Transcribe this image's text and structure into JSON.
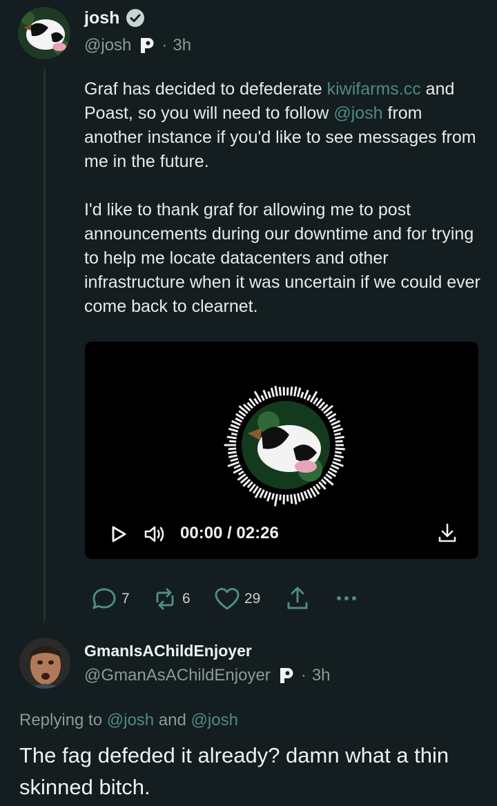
{
  "post": {
    "author_name": "josh",
    "handle": "@josh",
    "separator": "·",
    "time": "3h",
    "body": {
      "p1_part1": "Graf has decided to defederate ",
      "p1_link": "kiwifarms.cc",
      "p1_part2": " and Poast, so you will need to follow ",
      "p1_mention": "@josh",
      "p1_part3": " from another instance if you'd like to see messages from me in the future.",
      "p2": "I'd like to thank graf for allowing me to post announcements during our downtime and for trying to help me locate datacenters and other infrastructure when it was uncertain if we could ever come back to clearnet."
    },
    "video": {
      "current_time": "00:00",
      "time_separator": "/",
      "duration": "02:26"
    },
    "actions": {
      "replies": "7",
      "boosts": "6",
      "likes": "29"
    }
  },
  "reply": {
    "author_name": "GmanIsAChildEnjoyer",
    "handle": "@GmanAsAChildEnjoyer",
    "separator": "·",
    "time": "3h",
    "replying_prefix": "Replying to ",
    "replying_mention1": "@josh",
    "replying_and": " and ",
    "replying_mention2": "@josh",
    "body": "The fag defeded it already? damn what a thin skinned bitch."
  },
  "icons": {
    "verified": "verified-badge-icon",
    "instance": "poast-instance-icon",
    "play": "play-icon",
    "volume": "volume-icon",
    "download": "download-icon",
    "reply": "reply-icon",
    "boost": "boost-icon",
    "like": "heart-icon",
    "share": "share-icon",
    "more": "more-icon"
  },
  "colors": {
    "background": "#141d1f",
    "accent": "#4f8a86",
    "muted": "#8e9a9a",
    "text": "#e6ecec"
  }
}
